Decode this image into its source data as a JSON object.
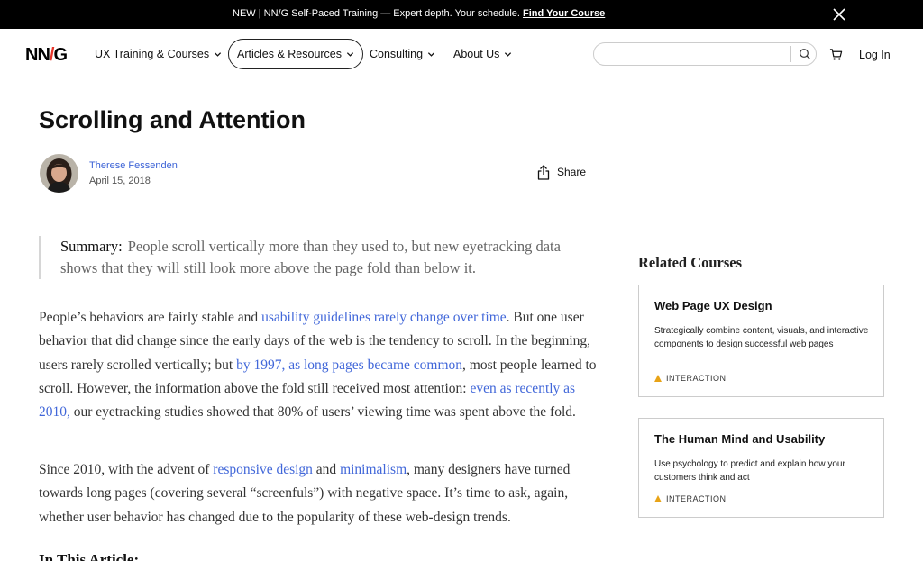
{
  "banner": {
    "message": "NEW | NN/G Self-Paced Training — Expert depth. Your schedule.",
    "link": "Find Your Course",
    "close_icon": "close-icon"
  },
  "header": {
    "logo": {
      "left": "NN",
      "slash": "/",
      "right": "G"
    },
    "nav": [
      {
        "label": "UX Training & Courses"
      },
      {
        "label": "Articles & Resources",
        "active": true
      },
      {
        "label": "Consulting"
      },
      {
        "label": "About Us"
      }
    ],
    "search": {
      "value": "",
      "placeholder": ""
    },
    "login": "Log In",
    "icons": {
      "search": "search-icon",
      "cart": "cart-icon",
      "chevron": "chevron-down-icon"
    }
  },
  "article": {
    "title": "Scrolling and Attention",
    "author": "Therese Fessenden",
    "date": "April 15, 2018",
    "share": "Share",
    "summary_label": "Summary:",
    "summary_text": "People scroll vertically more than they used to, but new eyetracking data shows that they will still look more above the page fold than below it.",
    "p1": {
      "t1": "People’s behaviors are fairly stable and ",
      "l1": "usability guidelines rarely change over time",
      "t2": ". But one user behavior that did change since the early days of the web is the tendency to scroll. In the beginning, users rarely scrolled vertically; but ",
      "l2": "by 1997, as long pages became common",
      "t3": ", most people learned to scroll. However, the information above the fold still received most attention: ",
      "l3": "even as recently as 2010,",
      "t4": " our eyetracking studies showed that 80% of users’ viewing time was spent above the fold."
    },
    "p2": {
      "t1": "Since 2010, with the advent of ",
      "l1": "responsive design",
      "t2": " and ",
      "l2": "minimalism",
      "t3": ", many designers have turned towards long pages (covering several “screenfuls”) with negative space. It’s time to ask, again, whether user behavior has changed due to the popularity of these web-design trends."
    },
    "toc_heading": "In This Article:"
  },
  "related": {
    "heading": "Related Courses",
    "courses": [
      {
        "title": "Web Page UX Design",
        "description": "Strategically combine content, visuals, and interactive components to design successful web pages",
        "tag": "INTERACTION"
      },
      {
        "title": "The Human Mind and Usability",
        "description": "Use psychology to predict and explain how your customers think and act",
        "tag": "INTERACTION"
      }
    ]
  },
  "colors": {
    "link": "#4167d9",
    "logo_accent": "#e8362b",
    "tag_triangle": "#e8a317",
    "banner_bg": "#000000"
  }
}
